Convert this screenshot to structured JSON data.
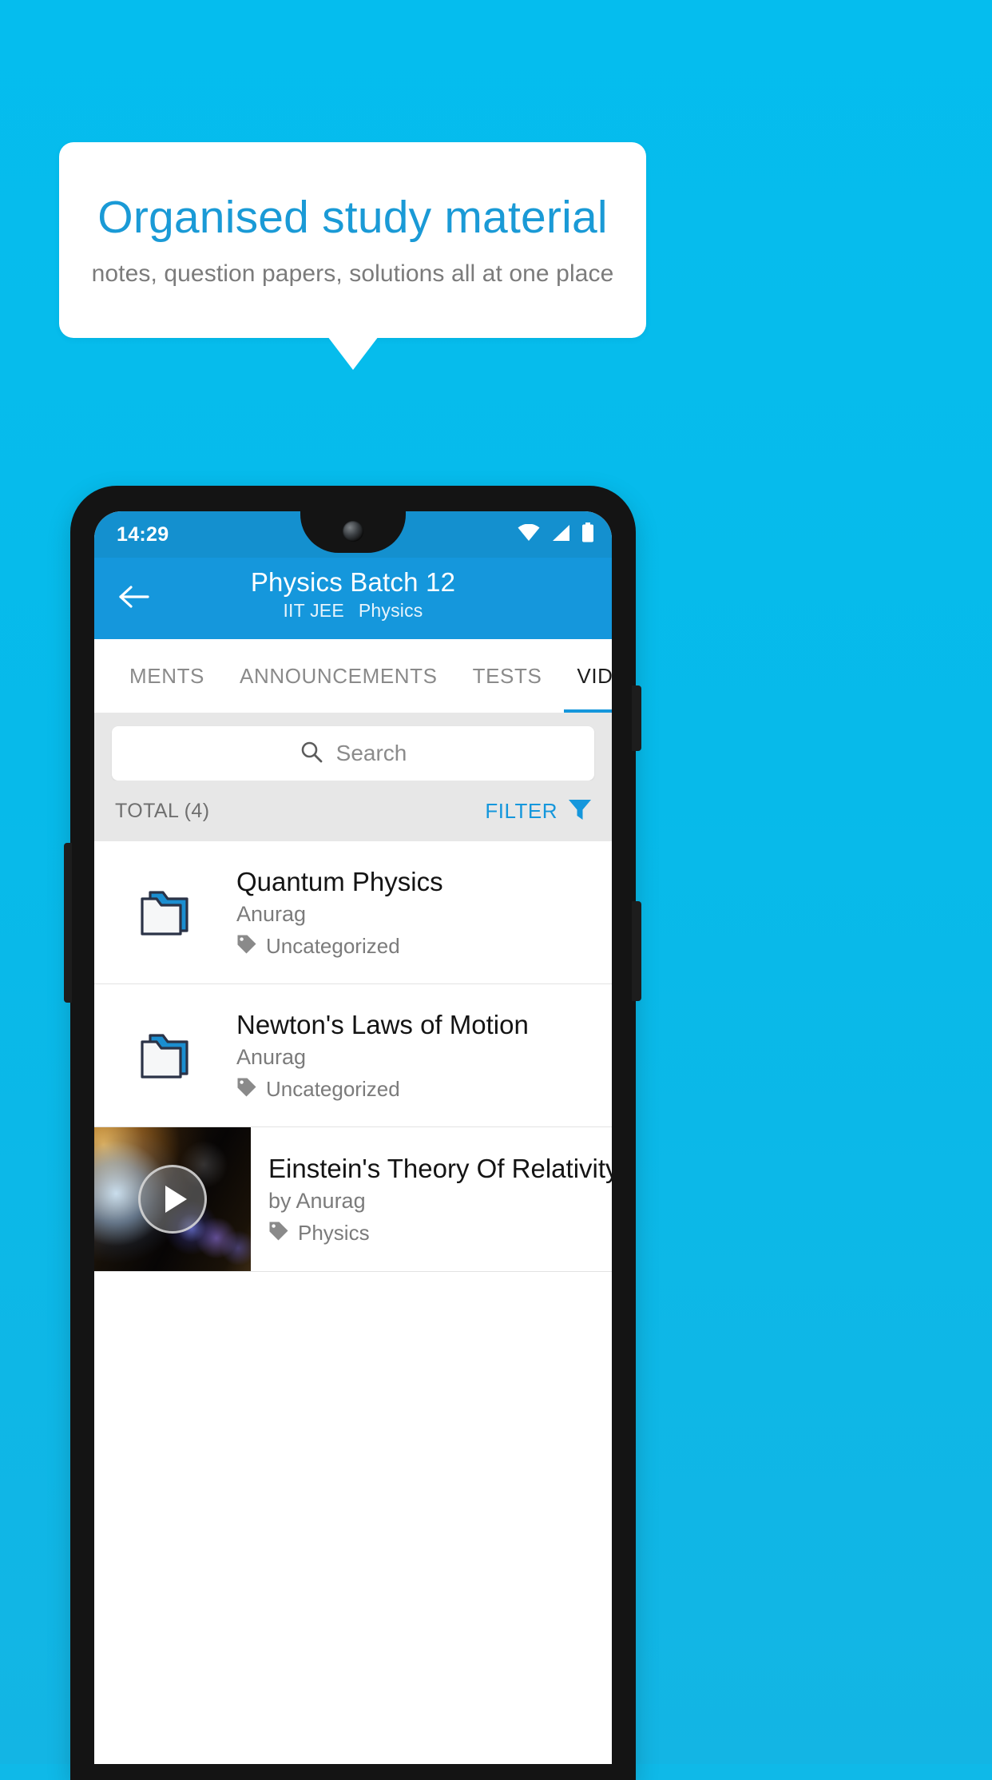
{
  "promo": {
    "title": "Organised study material",
    "subtitle": "notes, question papers, solutions all at one place",
    "accent_color": "#1a9ad6",
    "background_color": "#05bdee",
    "card_color": "#ffffff"
  },
  "phone": {
    "status_bar": {
      "time": "14:29",
      "icons": [
        "wifi-icon",
        "signal-icon",
        "battery-icon"
      ],
      "background_color": "#1490cf"
    },
    "app_bar": {
      "back_icon": "arrow-left-icon",
      "title": "Physics Batch 12",
      "subtitle_course": "IIT JEE",
      "subtitle_subject": "Physics",
      "background_color": "#1597dc"
    },
    "tabs": [
      {
        "label": "MENTS",
        "active": false
      },
      {
        "label": "ANNOUNCEMENTS",
        "active": false
      },
      {
        "label": "TESTS",
        "active": false
      },
      {
        "label": "VIDEOS",
        "active": true
      }
    ],
    "search": {
      "placeholder": "Search",
      "value": "",
      "icon": "search-icon"
    },
    "toolbar": {
      "total_label": "TOTAL (4)",
      "filter_label": "FILTER",
      "filter_icon": "filter-funnel-icon",
      "filter_color": "#1597dc"
    },
    "list": [
      {
        "type": "folder",
        "icon": "folder-icon",
        "title": "Quantum Physics",
        "author": "Anurag",
        "tag_icon": "tag-icon",
        "tag": "Uncategorized"
      },
      {
        "type": "folder",
        "icon": "folder-icon",
        "title": "Newton's Laws of Motion",
        "author": "Anurag",
        "tag_icon": "tag-icon",
        "tag": "Uncategorized"
      },
      {
        "type": "video",
        "icon": "video-thumbnail",
        "play_icon": "play-icon",
        "title": "Einstein's Theory Of Relativity",
        "author": "by Anurag",
        "tag_icon": "tag-icon",
        "tag": "Physics"
      }
    ]
  }
}
